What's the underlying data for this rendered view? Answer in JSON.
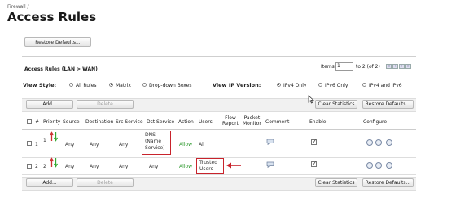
{
  "breadcrumb": "Firewall /",
  "page_title": "Access Rules",
  "buttons": {
    "restore_top": "Restore Defaults...",
    "add": "Add...",
    "delete": "Delete",
    "clear_stats": "Clear Statistics",
    "restore": "Restore Defaults..."
  },
  "section_title": "Access Rules (LAN > WAN)",
  "pagination": {
    "label": "Items",
    "value": "1",
    "range": "to 2 (of 2)"
  },
  "view_style": {
    "label": "View Style:",
    "options": [
      "All Rules",
      "Matrix",
      "Drop-down Boxes"
    ],
    "selected": "Matrix"
  },
  "ip_version": {
    "label": "View IP Version:",
    "options": [
      "IPv4 Only",
      "IPv6 Only",
      "IPv4 and IPv6"
    ],
    "selected": "IPv4 Only"
  },
  "columns": {
    "num": "#",
    "priority": "Priority",
    "source": "Source",
    "destination": "Destination",
    "src_service": "Src Service",
    "dst_service": "Dst Service",
    "action": "Action",
    "users": "Users",
    "flow_report_1": "Flow",
    "flow_report_2": "Report",
    "packet_monitor_1": "Packet",
    "packet_monitor_2": "Monitor",
    "comment": "Comment",
    "enable": "Enable",
    "configure": "Configure"
  },
  "rows": [
    {
      "num": "1",
      "priority": "1",
      "source": "Any",
      "destination": "Any",
      "src_service": "Any",
      "dst_service_l1": "DNS",
      "dst_service_l2": "(Name",
      "dst_service_l3": "Service)",
      "action": "Allow",
      "users": "All",
      "enabled": true
    },
    {
      "num": "2",
      "priority": "2",
      "source": "Any",
      "destination": "Any",
      "src_service": "Any",
      "dst_service": "Any",
      "action": "Allow",
      "users_l1": "Trusted",
      "users_l2": "Users",
      "enabled": true
    }
  ],
  "colors": {
    "allow": "#2e9a2e",
    "highlight": "#c8232c",
    "arrow_up": "#cc3333",
    "arrow_down": "#33aa33"
  }
}
